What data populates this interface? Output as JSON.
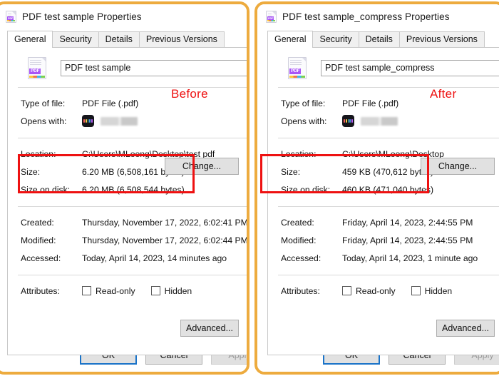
{
  "annotations": {
    "before": "Before",
    "after": "After",
    "highlight_color": "#ee1111"
  },
  "theme": {
    "window_border": "#edab3e",
    "accent": "#1a73c8",
    "pdf_tag": "PDF"
  },
  "panels": [
    {
      "id": "before",
      "titlebar": {
        "title": "PDF test sample Properties",
        "icon": "pdf-file-icon"
      },
      "tabs": [
        {
          "label": "General",
          "active": true
        },
        {
          "label": "Security",
          "active": false
        },
        {
          "label": "Details",
          "active": false
        },
        {
          "label": "Previous Versions",
          "active": false
        }
      ],
      "filename": "PDF test sample",
      "rows": {
        "type_label": "Type of file:",
        "type_value": "PDF File (.pdf)",
        "opens_label": "Opens with:",
        "opens_value": "",
        "change_button": "Change...",
        "location_label": "Location:",
        "location_value": "C:\\Users\\MLoong\\Desktop\\test pdf",
        "size_label": "Size:",
        "size_value": "6.20 MB (6,508,161 bytes)",
        "size_on_disk_label": "Size on disk:",
        "size_on_disk_value": "6.20 MB (6,508,544 bytes)",
        "created_label": "Created:",
        "created_value": "Thursday, November 17, 2022, 6:02:41 PM",
        "modified_label": "Modified:",
        "modified_value": "Thursday, November 17, 2022, 6:02:44 PM",
        "accessed_label": "Accessed:",
        "accessed_value": "Today, April 14, 2023, 14 minutes ago",
        "attributes_label": "Attributes:",
        "readonly_label": "Read-only",
        "hidden_label": "Hidden",
        "advanced_button": "Advanced..."
      },
      "footer": {
        "ok": "OK",
        "cancel": "Cancel",
        "apply": "Apply"
      }
    },
    {
      "id": "after",
      "titlebar": {
        "title": "PDF test sample_compress Properties",
        "icon": "pdf-file-icon"
      },
      "tabs": [
        {
          "label": "General",
          "active": true
        },
        {
          "label": "Security",
          "active": false
        },
        {
          "label": "Details",
          "active": false
        },
        {
          "label": "Previous Versions",
          "active": false
        }
      ],
      "filename": "PDF test sample_compress",
      "rows": {
        "type_label": "Type of file:",
        "type_value": "PDF File (.pdf)",
        "opens_label": "Opens with:",
        "opens_value": "",
        "change_button": "Change...",
        "location_label": "Location:",
        "location_value": "C:\\Users\\MLoong\\Desktop",
        "size_label": "Size:",
        "size_value": "459 KB (470,612 bytes)",
        "size_on_disk_label": "Size on disk:",
        "size_on_disk_value": "460 KB (471,040 bytes)",
        "created_label": "Created:",
        "created_value": "Friday, April 14, 2023, 2:44:55 PM",
        "modified_label": "Modified:",
        "modified_value": "Friday, April 14, 2023, 2:44:55 PM",
        "accessed_label": "Accessed:",
        "accessed_value": "Today, April 14, 2023, 1 minute ago",
        "attributes_label": "Attributes:",
        "readonly_label": "Read-only",
        "hidden_label": "Hidden",
        "advanced_button": "Advanced..."
      },
      "footer": {
        "ok": "OK",
        "cancel": "Cancel",
        "apply": "Apply"
      }
    }
  ]
}
